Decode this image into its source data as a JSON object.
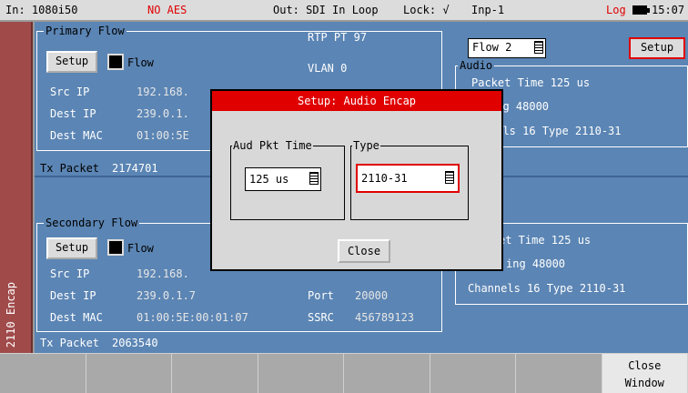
{
  "status": {
    "input": "In: 1080i50",
    "aes": "NO AES",
    "out": "Out: SDI In Loop",
    "lock": "Lock: √",
    "inp": "Inp-1",
    "log": "Log",
    "time": "15:07"
  },
  "sidetab": {
    "label": "2110 Encap"
  },
  "primary": {
    "legend": "Primary Flow",
    "setup": "Setup",
    "flow": "Flow",
    "src_ip_label": "Src IP",
    "src_ip": "192.168.",
    "dest_ip_label": "Dest IP",
    "dest_ip": "239.0.1.",
    "dest_mac_label": "Dest MAC",
    "dest_mac": "01:00:5E",
    "rtp_pt": "RTP PT  97",
    "vlan": "VLAN  0",
    "tx_label": "Tx Packet",
    "tx_value": "2174701"
  },
  "flow_select": {
    "value": "Flow 2",
    "setup": "Setup"
  },
  "audio": {
    "legend": "Audio",
    "packet_time": "Packet Time  125 us",
    "sampling": "ing  48000",
    "channels": "nels  16  Type  2110-31"
  },
  "secondary": {
    "legend": "Secondary Flow",
    "setup": "Setup",
    "flow": "Flow",
    "src_ip_label": "Src IP",
    "src_ip": "192.168.",
    "dest_ip_label": "Dest IP",
    "dest_ip": "239.0.1.7",
    "dest_mac_label": "Dest MAC",
    "dest_mac": "01:00:5E:00:01:07",
    "port_label": "Port",
    "port": "20000",
    "ssrc_label": "SSRC",
    "ssrc": "456789123",
    "tx_label": "Tx Packet",
    "tx_value": "2063540"
  },
  "audio2": {
    "packet_time": "et Time  125 us",
    "sampling": "ing  48000",
    "channels": "Channels  16  Type  2110-31"
  },
  "dialog": {
    "title": "Setup: Audio Encap",
    "pkt_legend": "Aud Pkt Time",
    "pkt_value": "125 us",
    "type_legend": "Type",
    "type_value": "2110-31",
    "close": "Close"
  },
  "softkeys": [
    {
      "line1": "",
      "line2": ""
    },
    {
      "line1": "",
      "line2": ""
    },
    {
      "line1": "",
      "line2": ""
    },
    {
      "line1": "",
      "line2": ""
    },
    {
      "line1": "",
      "line2": ""
    },
    {
      "line1": "",
      "line2": ""
    },
    {
      "line1": "",
      "line2": ""
    },
    {
      "line1": "Close",
      "line2": "Window"
    }
  ],
  "colors": {
    "accent": "#e00000",
    "panel": "#5b85b4",
    "sidetab": "#a04a4a"
  }
}
